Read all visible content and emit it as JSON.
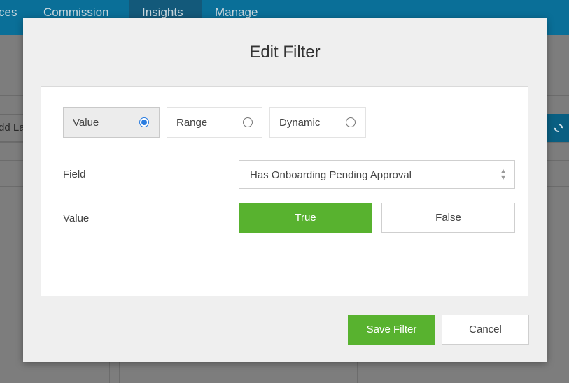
{
  "nav": {
    "items": [
      "ces",
      "Commission",
      "Insights",
      "Manage"
    ],
    "active": "Insights"
  },
  "background": {
    "add_label": "dd La",
    "refresh_icon": "refresh-icon"
  },
  "modal": {
    "title": "Edit Filter",
    "modes": [
      {
        "label": "Value",
        "selected": true
      },
      {
        "label": "Range",
        "selected": false
      },
      {
        "label": "Dynamic",
        "selected": false
      }
    ],
    "field_label": "Field",
    "field_value": "Has Onboarding Pending Approval",
    "value_label": "Value",
    "value_options": [
      {
        "label": "True",
        "active": true
      },
      {
        "label": "False",
        "active": false
      }
    ],
    "save_label": "Save Filter",
    "cancel_label": "Cancel",
    "accent_color": "#58b22f",
    "radio_color": "#2b7de0"
  }
}
